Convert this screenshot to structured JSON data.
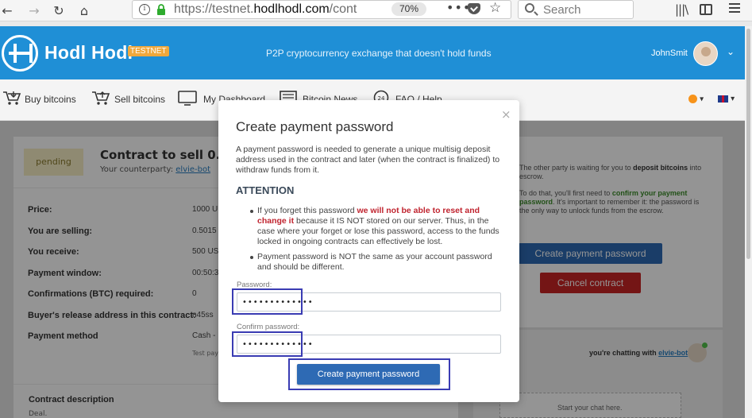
{
  "browser": {
    "url_prefix": "https://testnet.",
    "url_host": "hodlhodl.com",
    "url_suffix": "/cont",
    "zoom": "70%",
    "search_placeholder": "Search"
  },
  "header": {
    "logo_text": "Hodl Hodl",
    "badge": "TESTNET",
    "tagline": "P2P cryptocurrency exchange that doesn't hold funds",
    "username": "JohnSmit"
  },
  "nav": {
    "items": [
      "Buy bitcoins",
      "Sell bitcoins",
      "My Dashboard",
      "Bitcoin News",
      "FAQ / Help"
    ]
  },
  "contract": {
    "status": "pending",
    "title": "Contract to sell 0.501",
    "counterparty_label": "Your counterparty:",
    "counterparty": "elvie-bot",
    "rows": [
      {
        "label": "Price:",
        "value": "1000 U"
      },
      {
        "label": "You are selling:",
        "value": "0.5015"
      },
      {
        "label": "You receive:",
        "value": "500 US"
      },
      {
        "label": "Payment window:",
        "value": "00:50:3"
      },
      {
        "label": "Confirmations (BTC) required:",
        "value": "0"
      },
      {
        "label": "Buyer's release address in this contract:",
        "value": "n45ss"
      },
      {
        "label": "Payment method",
        "value": "Cash -"
      }
    ],
    "payment_note": "Test pay",
    "description_label": "Contract description",
    "description": "Deal."
  },
  "side": {
    "waiting_text_1": "The other party is waiting for you to",
    "waiting_bold": "deposit bitcoins",
    "waiting_text_2": "into escrow.",
    "todo_text_1": "To do that, you'll first need to",
    "todo_green": "confirm your payment password",
    "todo_text_2": ". It's important to remember it: the password is the only way to unlock funds from the escrow.",
    "create_btn": "Create payment password",
    "cancel_btn": "Cancel contract",
    "chatting_label": "you're chatting with",
    "chat_partner": "elvie-bot",
    "chat_placeholder": "Start your chat here."
  },
  "modal": {
    "close": "×",
    "title": "Create payment password",
    "description": "A payment password is needed to generate a unique multisig deposit address used in the contract and later (when the contract is finalized) to withdraw funds from it.",
    "attention": "ATTENTION",
    "bullet1_pre": "If you forget this password ",
    "bullet1_red": "we will not be able to reset and change it",
    "bullet1_post": " because it IS NOT stored on our server. Thus, in the case where your forget or lose this password, access to the funds locked in ongoing contracts can effectively be lost.",
    "bullet2": "Payment password is NOT the same as your account password and should be different.",
    "password_label": "Password:",
    "password_value": "•••••••••••••",
    "confirm_label": "Confirm password:",
    "confirm_value": "•••••••••••••",
    "submit": "Create payment password"
  }
}
